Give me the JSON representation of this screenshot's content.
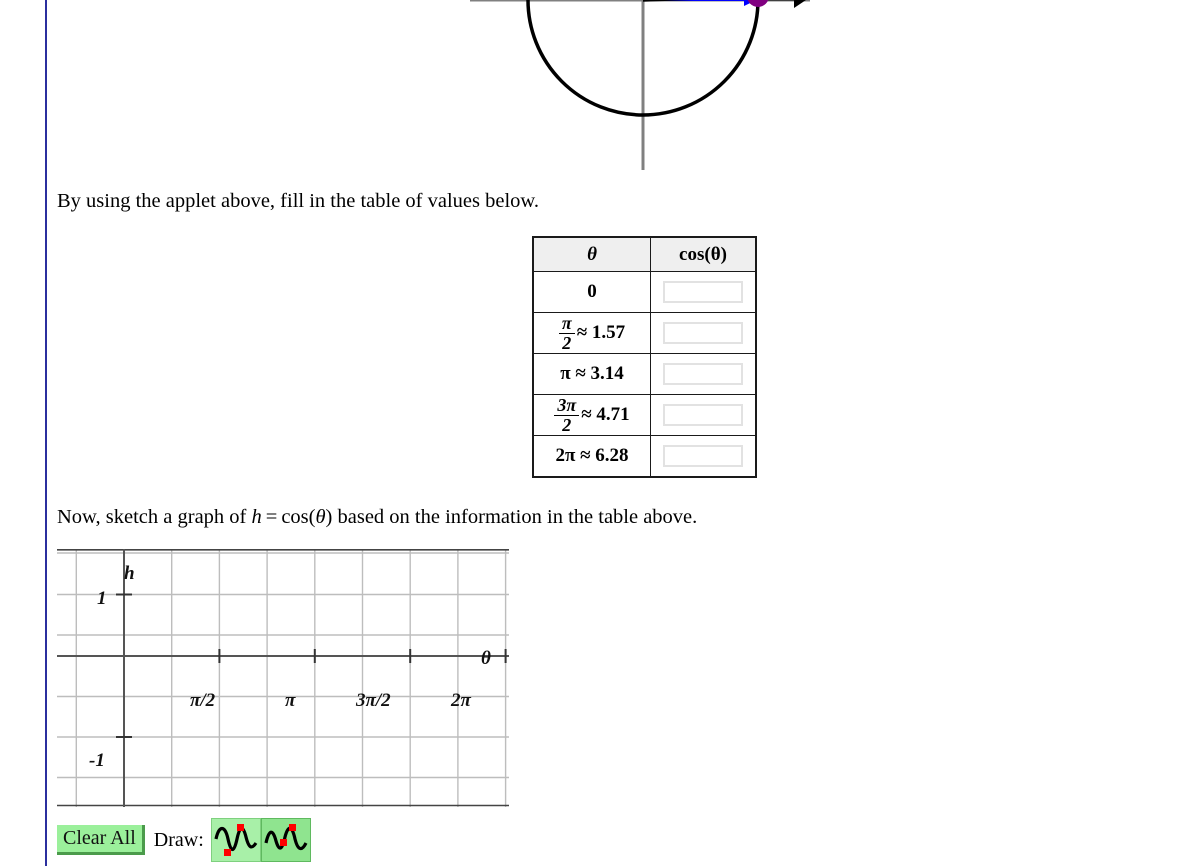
{
  "page": {
    "instruction_1": "By using the applet above, fill in the table of values below.",
    "instruction_2_pre": "Now, sketch a graph of ",
    "instruction_2_var": "h",
    "instruction_2_eq": "=",
    "instruction_2_fn": "cos(",
    "instruction_2_theta": "θ",
    "instruction_2_close": ")",
    "instruction_2_post": " based on the information in the table above."
  },
  "applet": {
    "name": "unit-circle-applet",
    "description": "unit circle with angle sweep",
    "colors": {
      "circle": "#000000",
      "axis": "#808080",
      "cosine_bar": "#0000ff",
      "red_marker": "#ff0000",
      "point": "#800080",
      "ray": "#000000"
    }
  },
  "table": {
    "headers": [
      "θ",
      "cos(θ)"
    ],
    "rows": [
      {
        "theta_display": "0",
        "theta_type": "plain",
        "numerator": "",
        "denominator": "",
        "approx": "",
        "answer_value": "",
        "answer_placeholder": ""
      },
      {
        "theta_display": "π/2 ≈ 1.57",
        "theta_type": "fraction",
        "numerator": "π",
        "denominator": "2",
        "approx": "≈ 1.57",
        "answer_value": "",
        "answer_placeholder": ""
      },
      {
        "theta_display": "π ≈ 3.14",
        "theta_type": "plain",
        "numerator": "",
        "denominator": "",
        "approx": "π ≈ 3.14",
        "answer_value": "",
        "answer_placeholder": ""
      },
      {
        "theta_display": "3π/2 ≈ 4.71",
        "theta_type": "fraction",
        "numerator": "3π",
        "denominator": "2",
        "approx": "≈ 4.71",
        "answer_value": "",
        "answer_placeholder": ""
      },
      {
        "theta_display": "2π ≈ 6.28",
        "theta_type": "plain",
        "numerator": "",
        "denominator": "",
        "approx": "2π ≈ 6.28",
        "answer_value": "",
        "answer_placeholder": ""
      }
    ]
  },
  "graph": {
    "y_axis_label": "h",
    "x_axis_label": "θ",
    "y_ticks": [
      "1",
      "-1"
    ],
    "x_ticks": [
      "π/2",
      "π",
      "3π/2",
      "2π"
    ],
    "grid_color": "#bdbdbd",
    "axis_color": "#555555"
  },
  "chart_data": {
    "type": "line",
    "title": "",
    "xlabel": "θ",
    "ylabel": "h",
    "xlim": [
      -0.55,
      7.4
    ],
    "ylim": [
      -1.85,
      1.85
    ],
    "x_tick_values": [
      1.5708,
      3.1416,
      4.7124,
      6.2832
    ],
    "x_tick_labels": [
      "π/2",
      "π",
      "3π/2",
      "2π"
    ],
    "y_tick_values": [
      1,
      -1
    ],
    "y_tick_labels": [
      "1",
      "-1"
    ],
    "grid": true,
    "legend": "none",
    "series": [
      {
        "name": "h = cos(θ)",
        "drawn": false,
        "x": [],
        "values": []
      }
    ]
  },
  "toolbar": {
    "clear_label": "Clear All",
    "draw_label": "Draw:",
    "tools": [
      {
        "name": "wave-tool-1",
        "selected": false
      },
      {
        "name": "wave-tool-2",
        "selected": true
      }
    ]
  }
}
